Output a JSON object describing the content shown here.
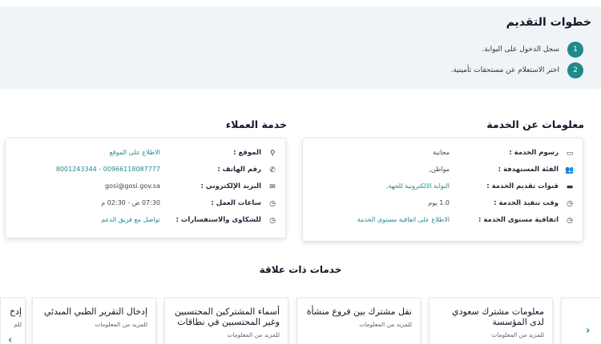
{
  "steps": {
    "title": "خطوات التقديم",
    "items": [
      {
        "num": "1",
        "text": "سجل الدخول على البوابة."
      },
      {
        "num": "2",
        "text": "اختر الاستعلام عن مستحقات تأمينية."
      }
    ]
  },
  "service_info": {
    "title": "معلومات عن الخدمة",
    "rows": [
      {
        "icon": "card-icon",
        "label": "رسوم الخدمة :",
        "value": "مجانية"
      },
      {
        "icon": "users-icon",
        "label": "الفئة المستهدفة :",
        "value": "مواطن,"
      },
      {
        "icon": "monitor-icon",
        "label": "قنوات تقديم الخدمة :",
        "value": "البوابة الالكترونية للجهة,"
      },
      {
        "icon": "clock-icon",
        "label": "وقت تنفيذ الخدمة :",
        "value": "1.0 يوم"
      },
      {
        "icon": "clock-icon",
        "label": "اتفاقية مستوى الخدمة :",
        "value": "الاطلاع على اتفاقية مستوى الخدمة"
      }
    ]
  },
  "customer_service": {
    "title": "خدمة العملاء",
    "rows": [
      {
        "icon": "location-icon",
        "label": "الموقع :",
        "value": "الاطلاع على الموقع"
      },
      {
        "icon": "phone-icon",
        "label": "رقم الهاتف :",
        "value": "8001243344 - 00966118087777"
      },
      {
        "icon": "mail-icon",
        "label": "البريد الإلكتروني :",
        "value": "gosi@gosi.gov.sa"
      },
      {
        "icon": "clock-icon",
        "label": "ساعات العمل :",
        "value": "07:30 ص - 02:30 م"
      },
      {
        "icon": "clock-icon",
        "label": "للشكاوى والاستفسارات :",
        "value": "تواصل مع فريق الدعم"
      }
    ]
  },
  "related": {
    "title": "خدمات ذات علاقة",
    "cards": [
      {
        "title": "معلومات مشترك سعودي لدى المؤسسة",
        "more": "للمزيد من المعلومات"
      },
      {
        "title": "نقل مشترك بين فروع منشأة",
        "more": "للمزيد من المعلومات"
      },
      {
        "title": "أسماء المشتركين المحتسبين وغير المحتسبين في نطاقات",
        "more": "للمزيد من المعلومات"
      },
      {
        "title": "إدخال التقرير الطبي المبدئي",
        "more": "للمزيد من المعلومات"
      },
      {
        "title": "إدخ",
        "more": "للم"
      }
    ],
    "prev_arrow": "‹",
    "next_arrow": "›"
  },
  "colors": {
    "accent": "#1f8a8a",
    "band": "#f1f4f7"
  }
}
